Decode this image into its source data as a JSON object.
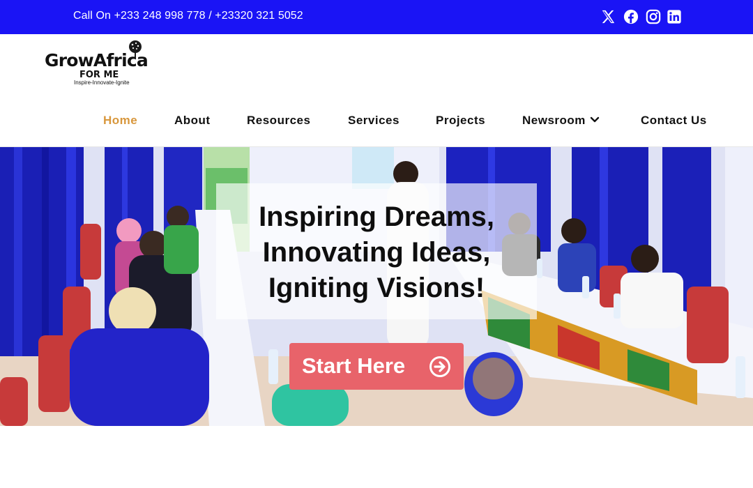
{
  "topbar": {
    "phone": "Call On +233 248 998 778 / +23320 321 5052",
    "social": [
      {
        "name": "x-icon"
      },
      {
        "name": "facebook-icon"
      },
      {
        "name": "instagram-icon"
      },
      {
        "name": "linkedin-icon"
      }
    ]
  },
  "logo": {
    "name": "GrowAfrica",
    "sub": "FOR ME",
    "tagline": "Inspire-Innovate-Ignite"
  },
  "nav": {
    "items": [
      {
        "label": "Home",
        "active": true
      },
      {
        "label": "About"
      },
      {
        "label": "Resources"
      },
      {
        "label": "Services"
      },
      {
        "label": "Projects"
      },
      {
        "label": "Newsroom",
        "icon": "chevron-down-icon"
      },
      {
        "label": "Contact Us"
      }
    ]
  },
  "hero": {
    "line1": "Inspiring Dreams,",
    "line2": "Innovating Ideas,",
    "line3": "Igniting Visions!",
    "cta": "Start Here",
    "cta_icon": "arrow-circle-right-icon"
  },
  "colors": {
    "topbar": "#1a14f5",
    "active_nav": "#d8973c",
    "cta": "#e8636a"
  }
}
